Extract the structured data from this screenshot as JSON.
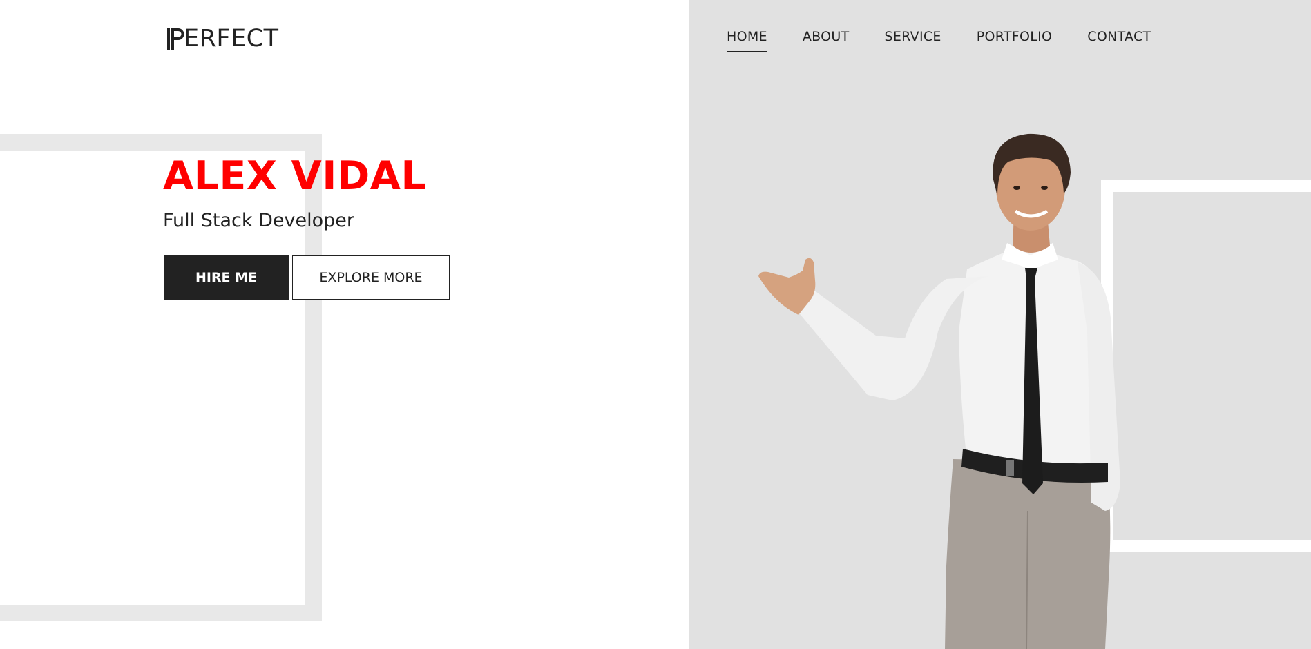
{
  "brand": {
    "logo_text": "ERFECT",
    "logo_letter": "P"
  },
  "nav": {
    "items": [
      {
        "label": "HOME",
        "active": true
      },
      {
        "label": "ABOUT",
        "active": false
      },
      {
        "label": "SERVICE",
        "active": false
      },
      {
        "label": "PORTFOLIO",
        "active": false
      },
      {
        "label": "CONTACT",
        "active": false
      }
    ]
  },
  "hero": {
    "name": "ALEX VIDAL",
    "role": "Full Stack Developer",
    "primary_button": "HIRE ME",
    "secondary_button": "EXPLORE MORE",
    "image": "businessman-presenting"
  },
  "colors": {
    "accent": "#ff0000",
    "dark": "#222222",
    "panel": "#e1e1e1",
    "frame": "#e8e8e8"
  }
}
